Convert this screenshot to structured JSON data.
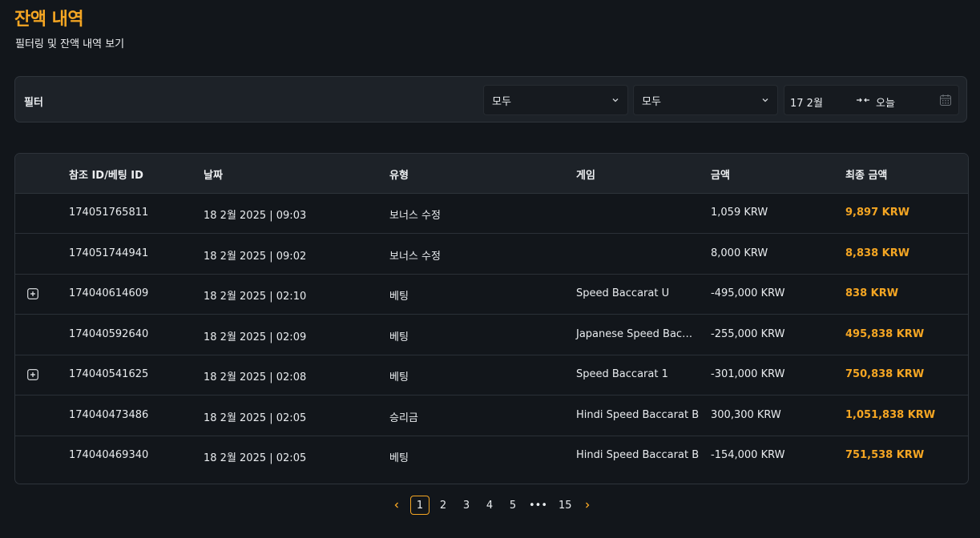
{
  "header": {
    "title": "잔액 내역",
    "subtitle": "필터링 및 잔액 내역 보기"
  },
  "filter": {
    "label": "필터",
    "select1_value": "모두",
    "select2_value": "모두",
    "date_from": "17 2월",
    "date_to": "오늘"
  },
  "table": {
    "headers": [
      "참조 ID/베팅 ID",
      "날짜",
      "유형",
      "게임",
      "금액",
      "최종 금액"
    ],
    "rows": [
      {
        "id": "174051765811",
        "date": "18 2월 2025 | 09:03",
        "type": "보너스 수정",
        "game": "",
        "amount": "1,059 KRW",
        "final": "9,897 KRW",
        "expandable": false
      },
      {
        "id": "174051744941",
        "date": "18 2월 2025 | 09:02",
        "type": "보너스 수정",
        "game": "",
        "amount": "8,000 KRW",
        "final": "8,838 KRW",
        "expandable": false
      },
      {
        "id": "174040614609",
        "date": "18 2월 2025 | 02:10",
        "type": "베팅",
        "game": "Speed Baccarat U",
        "amount": "-495,000 KRW",
        "final": "838 KRW",
        "expandable": true
      },
      {
        "id": "174040592640",
        "date": "18 2월 2025 | 02:09",
        "type": "베팅",
        "game": "Japanese Speed Bac…",
        "amount": "-255,000 KRW",
        "final": "495,838 KRW",
        "expandable": false
      },
      {
        "id": "174040541625",
        "date": "18 2월 2025 | 02:08",
        "type": "베팅",
        "game": "Speed Baccarat 1",
        "amount": "-301,000 KRW",
        "final": "750,838 KRW",
        "expandable": true
      },
      {
        "id": "174040473486",
        "date": "18 2월 2025 | 02:05",
        "type": "승리금",
        "game": "Hindi Speed Baccarat B",
        "amount": "300,300 KRW",
        "final": "1,051,838 KRW",
        "expandable": false
      },
      {
        "id": "174040469340",
        "date": "18 2월 2025 | 02:05",
        "type": "베팅",
        "game": "Hindi Speed Baccarat B",
        "amount": "-154,000 KRW",
        "final": "751,538 KRW",
        "expandable": false
      }
    ]
  },
  "pagination": {
    "pages": [
      "1",
      "2",
      "3",
      "4",
      "5",
      "•••",
      "15"
    ],
    "current": "1"
  },
  "colors": {
    "accent": "#f5a623",
    "background": "#12161b",
    "panel": "#1d2228"
  },
  "icons": [
    "chevron-down-icon",
    "swap-arrows-icon",
    "calendar-icon",
    "expand-plus-icon",
    "chevron-left-icon",
    "chevron-right-icon"
  ]
}
